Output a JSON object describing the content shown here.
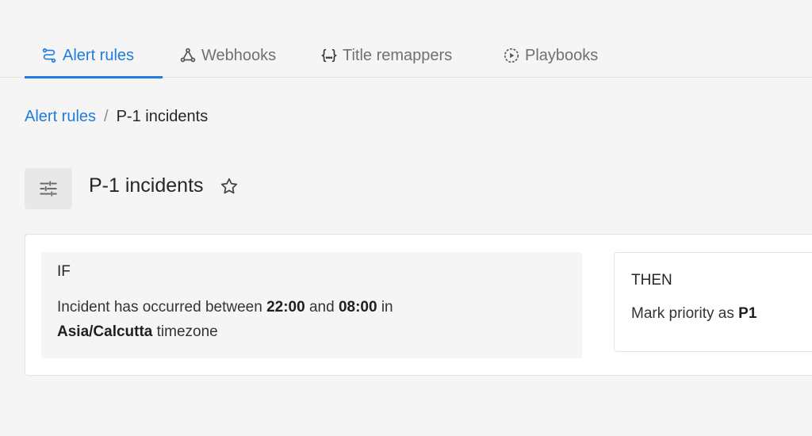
{
  "tabs": [
    {
      "label": "Alert rules",
      "icon": "route-icon",
      "active": true
    },
    {
      "label": "Webhooks",
      "icon": "webhook-icon",
      "active": false
    },
    {
      "label": "Title remappers",
      "icon": "braces-icon",
      "active": false
    },
    {
      "label": "Playbooks",
      "icon": "play-circle-icon",
      "active": false
    }
  ],
  "breadcrumb": {
    "parent": "Alert rules",
    "separator": "/",
    "current": "P-1 incidents"
  },
  "rule": {
    "title": "P-1 incidents",
    "icon": "sliders-icon",
    "favorite_icon": "star-icon"
  },
  "condition": {
    "heading": "IF",
    "prefix": "Incident has occurred between ",
    "start_time": "22:00",
    "and_word": " and ",
    "end_time": "08:00",
    "in_word": " in",
    "timezone": "Asia/Calcutta",
    "suffix": " timezone"
  },
  "action": {
    "heading": "THEN",
    "prefix": "Mark priority as ",
    "priority": "P1"
  },
  "colors": {
    "accent": "#1f7ce0",
    "background": "#f5f5f5",
    "card": "#ffffff",
    "border": "#e3e3e3"
  }
}
